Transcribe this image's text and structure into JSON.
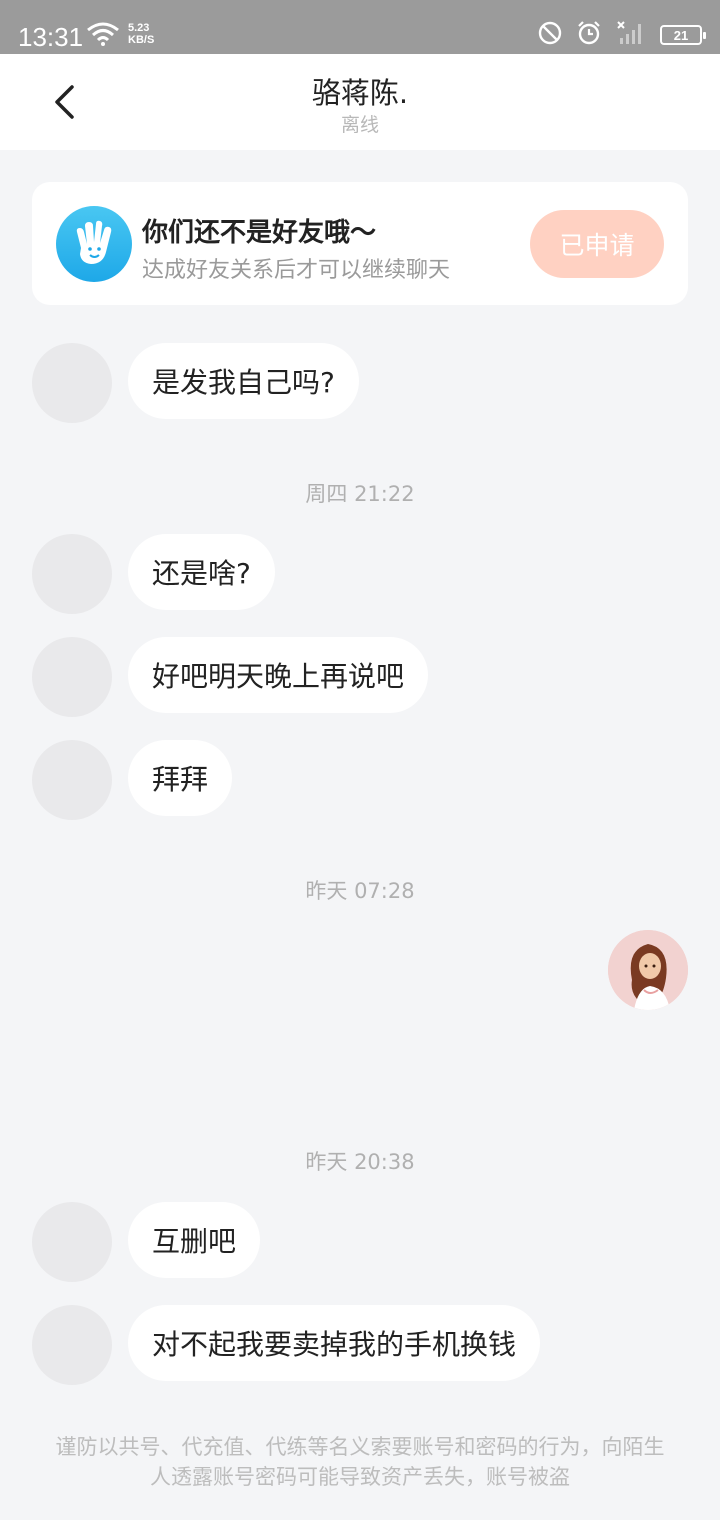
{
  "status_bar": {
    "time": "13:31",
    "net_speed_value": "5.23",
    "net_speed_unit": "KB/S",
    "battery": "21"
  },
  "header": {
    "title": "骆蒋陈.",
    "status": "离线"
  },
  "friend_notice": {
    "title": "你们还不是好友哦～",
    "subtitle": "达成好友关系后才可以继续聊天",
    "button_label": "已申请"
  },
  "messages": [
    {
      "text": "是发我自己吗?"
    },
    {
      "text": "还是啥?"
    },
    {
      "text": "好吧明天晚上再说吧"
    },
    {
      "text": "拜拜"
    },
    {
      "text": "互删吧"
    },
    {
      "text": "对不起我要卖掉我的手机换钱"
    }
  ],
  "timestamps": [
    "周四 21:22",
    "昨天 07:28",
    "昨天 20:38"
  ],
  "footer_warning": "谨防以共号、代充值、代练等名义索要账号和密码的行为，向陌生人透露账号密码可能导致资产丢失，账号被盗",
  "colors": {
    "apply_button": "#ffd1c2",
    "notice_icon": "#2eb4ec",
    "background": "#f4f5f7"
  }
}
